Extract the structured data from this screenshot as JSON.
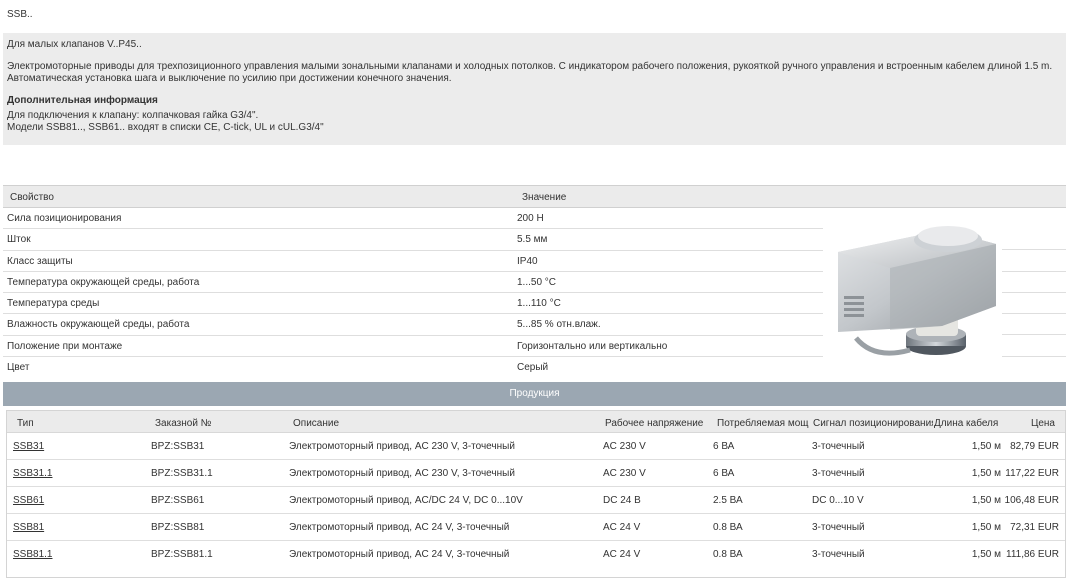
{
  "page": {
    "title": "SSB.."
  },
  "info": {
    "subtitle": "Для малых клапанов V..P45..",
    "description_line1": "Электромоторные приводы для трехпозиционного управления малыми зональными клапанами и холодных потолков. С индикатором рабочего положения, рукояткой ручного управления и встроенным кабелем длиной 1.5 m.",
    "description_line2": "Автоматическая установка шага и выключение по усилию при достижении конечного значения.",
    "additional_heading": "Дополнительная информация",
    "additional_line1": "Для подключения к клапану: колпачковая гайка G3/4\".",
    "additional_line2": "Модели SSB81.., SSB61.. входят в списки CE, C-tick, UL и cUL.G3/4\""
  },
  "properties": {
    "header_name": "Свойство",
    "header_value": "Значение",
    "rows": [
      {
        "name": "Сила позиционирования",
        "value": "200 Н"
      },
      {
        "name": "Шток",
        "value": "5.5 мм"
      },
      {
        "name": "Класс защиты",
        "value": "IP40"
      },
      {
        "name": "Температура окружающей среды, работа",
        "value": "1...50 °C"
      },
      {
        "name": "Температура среды",
        "value": "1...110 °C"
      },
      {
        "name": "Влажность окружающей среды, работа",
        "value": "5...85 % отн.влаж."
      },
      {
        "name": "Положение при монтаже",
        "value": "Горизонтально или вертикально"
      },
      {
        "name": "Цвет",
        "value": "Серый"
      }
    ]
  },
  "products": {
    "bar_title": "Продукция",
    "headers": {
      "type": "Тип",
      "order": "Заказной №",
      "description": "Описание",
      "voltage": "Рабочее напряжение",
      "power": "Потребляемая мощ",
      "signal": "Сигнал позиционирования",
      "cable": "Длина кабеля",
      "price": "Цена"
    },
    "rows": [
      {
        "type": "SSB31",
        "order": "BPZ:SSB31",
        "description": "Электромоторный привод, AC 230 V, 3-точечный",
        "voltage": "AC 230 V",
        "power": "6 ВА",
        "signal": "3-точечный",
        "cable": "1,50 м",
        "price": "82,79 EUR"
      },
      {
        "type": "SSB31.1",
        "order": "BPZ:SSB31.1",
        "description": "Электромоторный привод, AC 230 V, 3-точечный",
        "voltage": "AC 230 V",
        "power": "6 ВА",
        "signal": "3-точечный",
        "cable": "1,50 м",
        "price": "117,22 EUR"
      },
      {
        "type": "SSB61",
        "order": "BPZ:SSB61",
        "description": "Электромоторный привод, AC/DC 24 V, DC 0...10V",
        "voltage": "DC 24 В",
        "power": "2.5 ВА",
        "signal": "DC 0...10 V",
        "cable": "1,50 м",
        "price": "106,48 EUR"
      },
      {
        "type": "SSB81",
        "order": "BPZ:SSB81",
        "description": "Электромоторный привод, AC 24 V, 3-точечный",
        "voltage": "AC 24 V",
        "power": "0.8 ВА",
        "signal": "3-точечный",
        "cable": "1,50 м",
        "price": "72,31 EUR"
      },
      {
        "type": "SSB81.1",
        "order": "BPZ:SSB81.1",
        "description": "Электромоторный привод, AC 24 V, 3-точечный",
        "voltage": "AC 24 V",
        "power": "0.8 ВА",
        "signal": "3-точечный",
        "cable": "1,50 м",
        "price": "111,86 EUR"
      }
    ]
  },
  "colors": {
    "products_bar": "#9ba7b2",
    "info_background": "#ececec",
    "header_background": "#ebebeb"
  },
  "image": {
    "icon": "actuator-product-image"
  }
}
